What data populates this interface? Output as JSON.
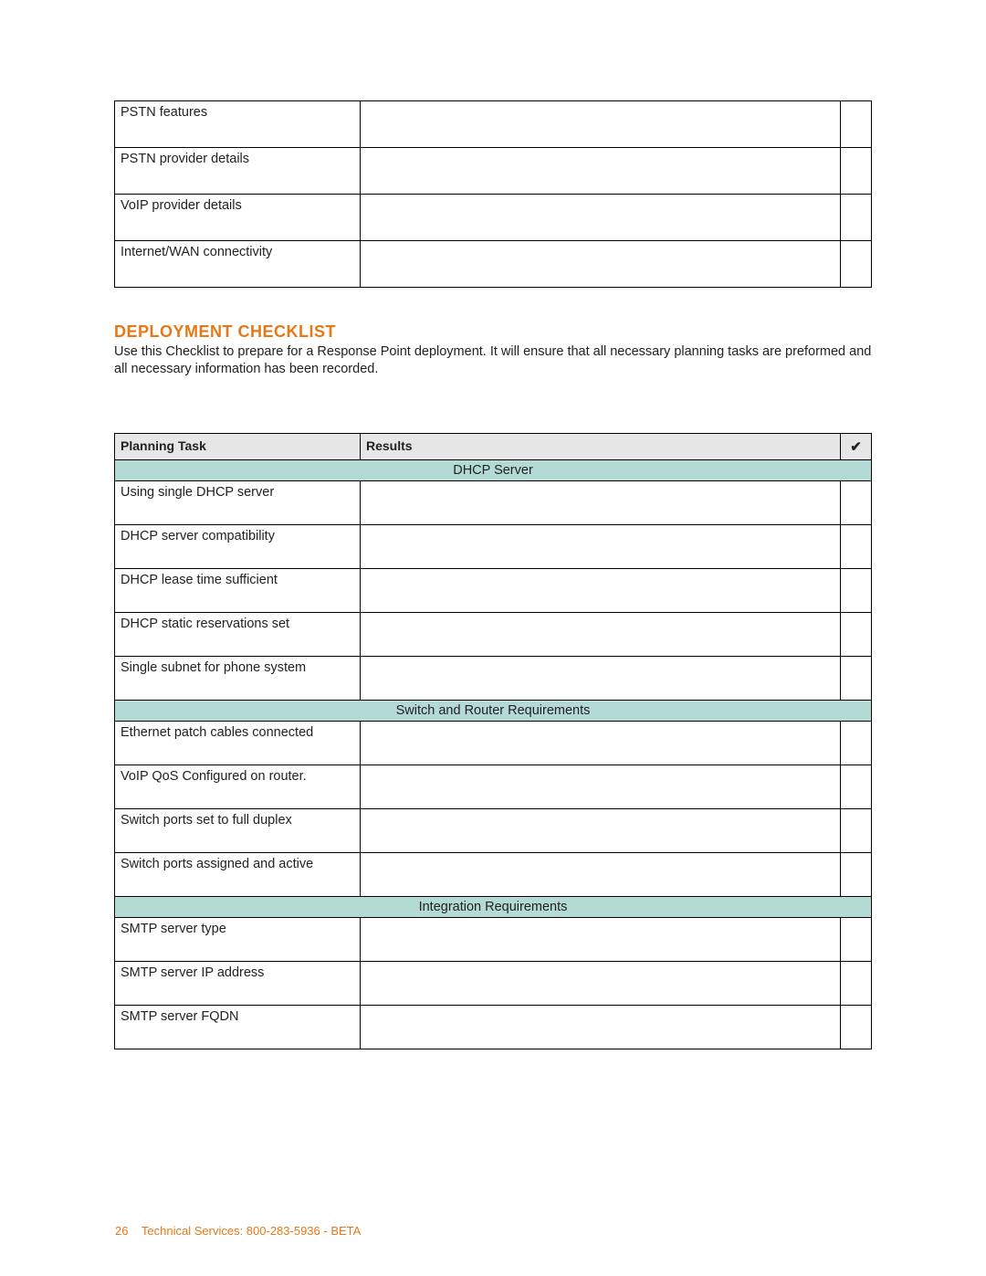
{
  "top_table": {
    "rows": [
      "PSTN features",
      "PSTN provider details",
      "VoIP provider details",
      "Internet/WAN connectivity"
    ]
  },
  "deployment": {
    "title": "DEPLOYMENT CHECKLIST",
    "intro": "Use this Checklist to prepare for a Response Point deployment. It will ensure that all necessary planning tasks are preformed and all necessary information has been recorded."
  },
  "checklist": {
    "headers": {
      "planning": "Planning Task",
      "results": "Results",
      "check": "✔"
    },
    "groups": [
      {
        "section": "DHCP Server",
        "rows": [
          "Using single DHCP server",
          "DHCP server compatibility",
          "DHCP lease time sufficient",
          "DHCP static reservations set",
          "Single subnet for phone system"
        ]
      },
      {
        "section": "Switch and Router Requirements",
        "rows": [
          "Ethernet patch cables connected",
          "VoIP QoS Configured on router.",
          "Switch ports set to full duplex",
          "Switch ports assigned and active"
        ]
      },
      {
        "section": "Integration Requirements",
        "rows": [
          "SMTP server type",
          "SMTP server IP address",
          "SMTP server FQDN"
        ]
      }
    ]
  },
  "footer": {
    "page": "26",
    "text": "Technical Services: 800-283-5936 - BETA"
  }
}
